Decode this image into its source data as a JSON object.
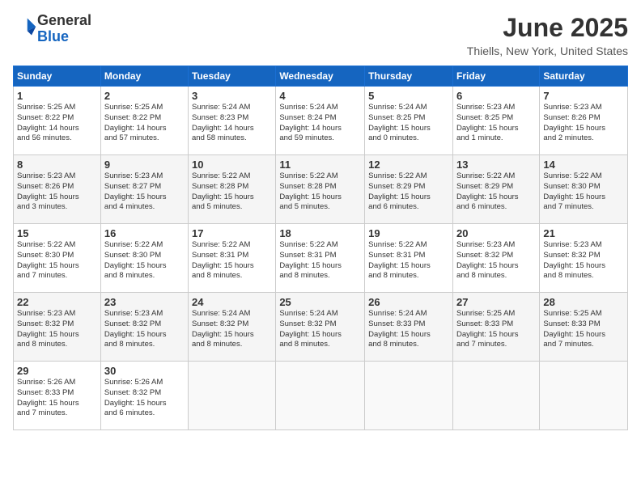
{
  "header": {
    "logo_general": "General",
    "logo_blue": "Blue",
    "month": "June 2025",
    "location": "Thiells, New York, United States"
  },
  "days_of_week": [
    "Sunday",
    "Monday",
    "Tuesday",
    "Wednesday",
    "Thursday",
    "Friday",
    "Saturday"
  ],
  "weeks": [
    [
      {
        "day": "1",
        "info": "Sunrise: 5:25 AM\nSunset: 8:22 PM\nDaylight: 14 hours\nand 56 minutes."
      },
      {
        "day": "2",
        "info": "Sunrise: 5:25 AM\nSunset: 8:22 PM\nDaylight: 14 hours\nand 57 minutes."
      },
      {
        "day": "3",
        "info": "Sunrise: 5:24 AM\nSunset: 8:23 PM\nDaylight: 14 hours\nand 58 minutes."
      },
      {
        "day": "4",
        "info": "Sunrise: 5:24 AM\nSunset: 8:24 PM\nDaylight: 14 hours\nand 59 minutes."
      },
      {
        "day": "5",
        "info": "Sunrise: 5:24 AM\nSunset: 8:25 PM\nDaylight: 15 hours\nand 0 minutes."
      },
      {
        "day": "6",
        "info": "Sunrise: 5:23 AM\nSunset: 8:25 PM\nDaylight: 15 hours\nand 1 minute."
      },
      {
        "day": "7",
        "info": "Sunrise: 5:23 AM\nSunset: 8:26 PM\nDaylight: 15 hours\nand 2 minutes."
      }
    ],
    [
      {
        "day": "8",
        "info": "Sunrise: 5:23 AM\nSunset: 8:26 PM\nDaylight: 15 hours\nand 3 minutes."
      },
      {
        "day": "9",
        "info": "Sunrise: 5:23 AM\nSunset: 8:27 PM\nDaylight: 15 hours\nand 4 minutes."
      },
      {
        "day": "10",
        "info": "Sunrise: 5:22 AM\nSunset: 8:28 PM\nDaylight: 15 hours\nand 5 minutes."
      },
      {
        "day": "11",
        "info": "Sunrise: 5:22 AM\nSunset: 8:28 PM\nDaylight: 15 hours\nand 5 minutes."
      },
      {
        "day": "12",
        "info": "Sunrise: 5:22 AM\nSunset: 8:29 PM\nDaylight: 15 hours\nand 6 minutes."
      },
      {
        "day": "13",
        "info": "Sunrise: 5:22 AM\nSunset: 8:29 PM\nDaylight: 15 hours\nand 6 minutes."
      },
      {
        "day": "14",
        "info": "Sunrise: 5:22 AM\nSunset: 8:30 PM\nDaylight: 15 hours\nand 7 minutes."
      }
    ],
    [
      {
        "day": "15",
        "info": "Sunrise: 5:22 AM\nSunset: 8:30 PM\nDaylight: 15 hours\nand 7 minutes."
      },
      {
        "day": "16",
        "info": "Sunrise: 5:22 AM\nSunset: 8:30 PM\nDaylight: 15 hours\nand 8 minutes."
      },
      {
        "day": "17",
        "info": "Sunrise: 5:22 AM\nSunset: 8:31 PM\nDaylight: 15 hours\nand 8 minutes."
      },
      {
        "day": "18",
        "info": "Sunrise: 5:22 AM\nSunset: 8:31 PM\nDaylight: 15 hours\nand 8 minutes."
      },
      {
        "day": "19",
        "info": "Sunrise: 5:22 AM\nSunset: 8:31 PM\nDaylight: 15 hours\nand 8 minutes."
      },
      {
        "day": "20",
        "info": "Sunrise: 5:23 AM\nSunset: 8:32 PM\nDaylight: 15 hours\nand 8 minutes."
      },
      {
        "day": "21",
        "info": "Sunrise: 5:23 AM\nSunset: 8:32 PM\nDaylight: 15 hours\nand 8 minutes."
      }
    ],
    [
      {
        "day": "22",
        "info": "Sunrise: 5:23 AM\nSunset: 8:32 PM\nDaylight: 15 hours\nand 8 minutes."
      },
      {
        "day": "23",
        "info": "Sunrise: 5:23 AM\nSunset: 8:32 PM\nDaylight: 15 hours\nand 8 minutes."
      },
      {
        "day": "24",
        "info": "Sunrise: 5:24 AM\nSunset: 8:32 PM\nDaylight: 15 hours\nand 8 minutes."
      },
      {
        "day": "25",
        "info": "Sunrise: 5:24 AM\nSunset: 8:32 PM\nDaylight: 15 hours\nand 8 minutes."
      },
      {
        "day": "26",
        "info": "Sunrise: 5:24 AM\nSunset: 8:33 PM\nDaylight: 15 hours\nand 8 minutes."
      },
      {
        "day": "27",
        "info": "Sunrise: 5:25 AM\nSunset: 8:33 PM\nDaylight: 15 hours\nand 7 minutes."
      },
      {
        "day": "28",
        "info": "Sunrise: 5:25 AM\nSunset: 8:33 PM\nDaylight: 15 hours\nand 7 minutes."
      }
    ],
    [
      {
        "day": "29",
        "info": "Sunrise: 5:26 AM\nSunset: 8:33 PM\nDaylight: 15 hours\nand 7 minutes."
      },
      {
        "day": "30",
        "info": "Sunrise: 5:26 AM\nSunset: 8:32 PM\nDaylight: 15 hours\nand 6 minutes."
      },
      null,
      null,
      null,
      null,
      null
    ]
  ]
}
